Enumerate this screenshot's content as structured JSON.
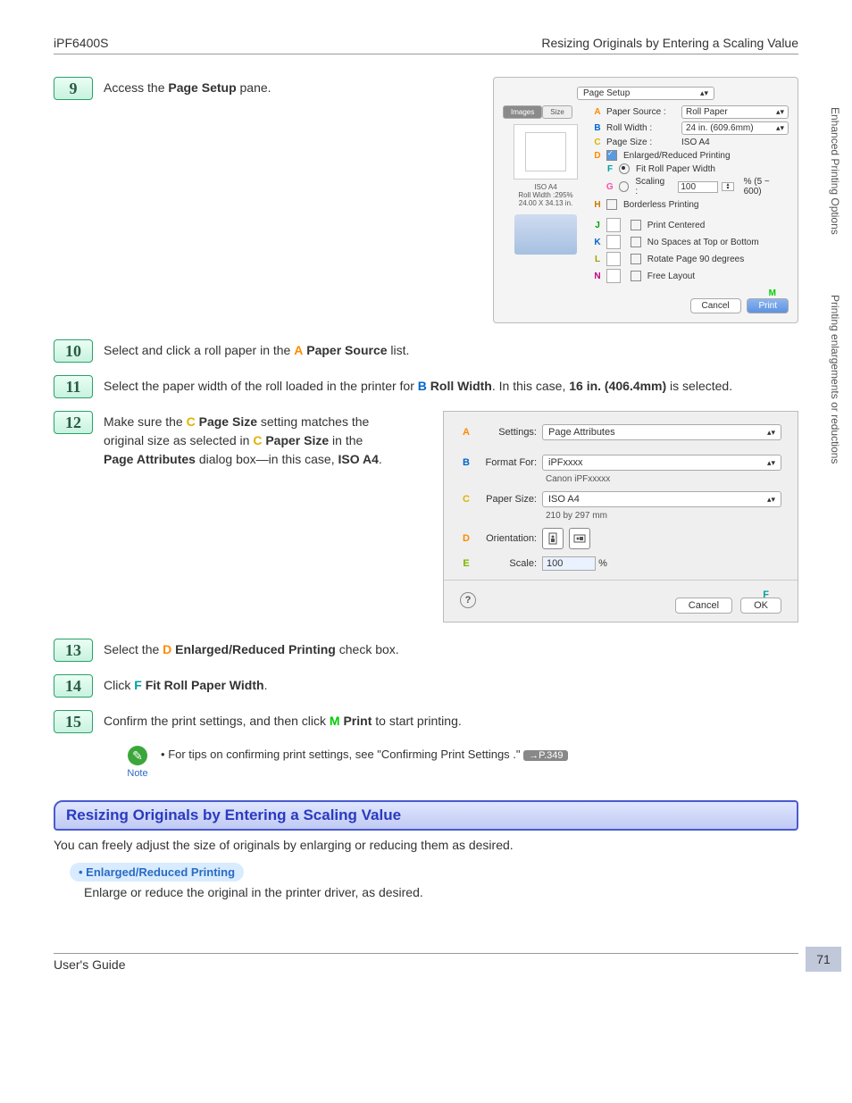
{
  "header": {
    "left": "iPF6400S",
    "right": "Resizing Originals by Entering a Scaling Value"
  },
  "footer": {
    "left": "User's Guide"
  },
  "pagenum": "71",
  "sidetabs": {
    "t1": "Enhanced Printing Options",
    "t2": "Printing enlargements or reductions"
  },
  "dialogA": {
    "hdr": "Page Setup",
    "tab_images": "Images",
    "tab_size": "Size",
    "A_label": "Paper Source :",
    "A_value": "Roll Paper",
    "B_label": "Roll Width :",
    "B_value": "24 in. (609.6mm)",
    "C_label": "Page Size :",
    "C_value": "ISO A4",
    "D_label": "Enlarged/Reduced Printing",
    "F_label": "Fit Roll Paper Width",
    "G_label": "Scaling :",
    "G_value": "100",
    "G_after": "% (5 ~ 600)",
    "H_label": "Borderless Printing",
    "J_label": "Print Centered",
    "K_label": "No Spaces at Top or Bottom",
    "L_label": "Rotate Page 90 degrees",
    "N_label": "Free Layout",
    "left_line1": "ISO A4",
    "left_line2": "Roll Width :295%",
    "left_line3": "24.00 X 34.13 in.",
    "M_text": "M",
    "btn_cancel": "Cancel",
    "btn_print": "Print"
  },
  "dialogB": {
    "A_label": "Settings:",
    "A_value": "Page Attributes",
    "B_label": "Format For:",
    "B_value": "iPFxxxx",
    "B_sub": "Canon iPFxxxxx",
    "C_label": "Paper Size:",
    "C_value": "ISO A4",
    "C_sub": "210 by 297 mm",
    "D_label": "Orientation:",
    "E_label": "Scale:",
    "E_value": "100",
    "E_after": "%",
    "F_text": "F",
    "btn_cancel": "Cancel",
    "btn_ok": "OK"
  },
  "steps": {
    "n9": "9",
    "t9a": "Access the ",
    "t9b": "Page Setup",
    "t9c": " pane.",
    "n10": "10",
    "t10a": "Select and click a roll paper in the ",
    "t10l": "A",
    "t10b": "Paper Source",
    "t10c": " list.",
    "n11": "11",
    "t11a": "Select the paper width of the roll loaded in the printer for ",
    "t11l": "B",
    "t11b": "Roll Width",
    "t11c": ". In this case, ",
    "t11d": "16 in. (406.4mm)",
    "t11e": " is selected.",
    "n12": "12",
    "t12a": "Make sure the ",
    "t12l1": "C",
    "t12b": "Page Size",
    "t12c": " setting matches the original size as selected in ",
    "t12l2": "C",
    "t12d": "Paper Size",
    "t12e": " in the ",
    "t12f": "Page Attributes",
    "t12g": " dialog box—in this case, ",
    "t12h": "ISO A4",
    "t12i": ".",
    "n13": "13",
    "t13a": "Select the ",
    "t13l": "D",
    "t13b": "Enlarged/Reduced Printing",
    "t13c": " check box.",
    "n14": "14",
    "t14a": "Click ",
    "t14l": "F",
    "t14b": "Fit Roll Paper Width",
    "t14c": ".",
    "n15": "15",
    "t15a": "Confirm the print settings, and then click ",
    "t15l": "M",
    "t15b": "Print",
    "t15c": " to start printing."
  },
  "note": {
    "label": "Note",
    "bullet": "•",
    "t1": "For tips on confirming print settings, see \"Confirming Print Settings .\"",
    "link": "→P.349"
  },
  "section": {
    "title": "Resizing Originals by Entering a Scaling Value",
    "desc": "You can freely adjust the size of originals by enlarging or reducing them as desired.",
    "bullet_title": "Enlarged/Reduced Printing",
    "bullet_body": "Enlarge or reduce the original in the printer driver, as desired."
  }
}
